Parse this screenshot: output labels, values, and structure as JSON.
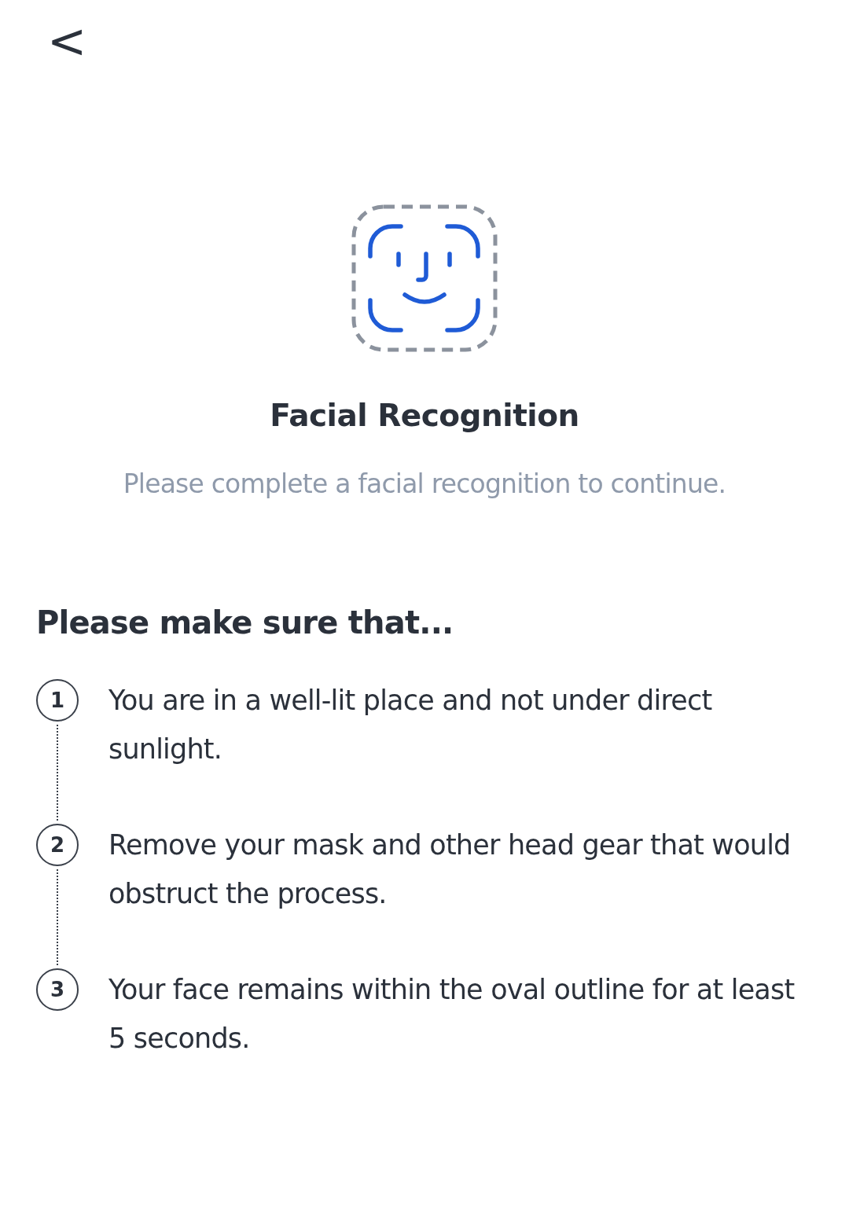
{
  "back_button": {
    "label": "<"
  },
  "title": "Facial Recognition",
  "subtitle": "Please complete a facial recognition to continue.",
  "checklist": {
    "heading": "Please make sure that...",
    "steps": [
      {
        "number": "1",
        "text": "You are in a well-lit place and not under direct sunlight."
      },
      {
        "number": "2",
        "text": "Remove your mask and other head gear that would obstruct the process."
      },
      {
        "number": "3",
        "text": "Your face remains within the oval outline for at least 5 seconds."
      }
    ]
  }
}
